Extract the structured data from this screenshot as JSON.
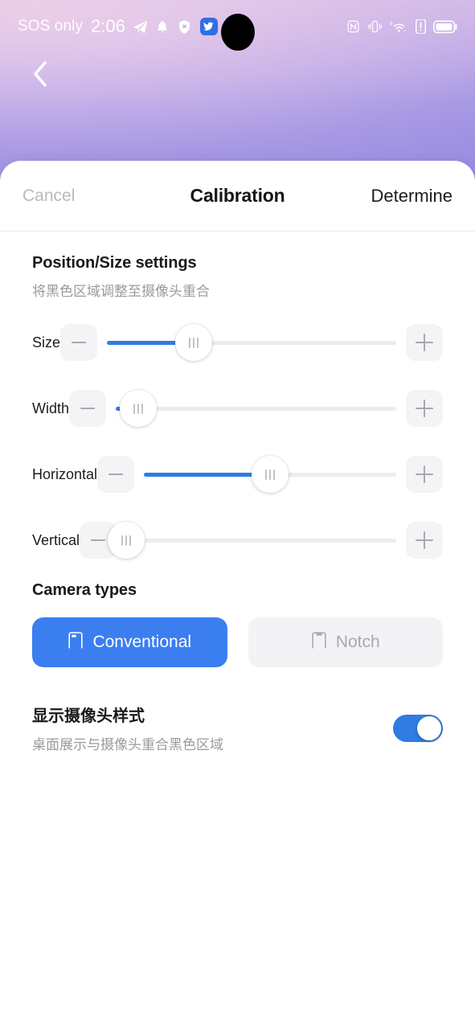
{
  "statusbar": {
    "carrier": "SOS only",
    "time": "2:06",
    "left_icons": [
      "telegram-icon",
      "bell-icon",
      "shield-icon",
      "bird-app-icon",
      "running-app-icon"
    ],
    "right_icons": [
      "nfc-icon",
      "vibrate-icon",
      "wifi6-icon",
      "alert-icon",
      "battery-icon"
    ]
  },
  "nav": {
    "back": "back-chevron"
  },
  "sheet": {
    "cancel_label": "Cancel",
    "title": "Calibration",
    "determine_label": "Determine"
  },
  "position_section": {
    "title": "Position/Size settings",
    "subtitle": "将黑色区域调整至摄像头重合",
    "minus_label": "−",
    "plus_label": "+",
    "sliders": [
      {
        "label": "Size",
        "value": 30
      },
      {
        "label": "Width",
        "value": 8
      },
      {
        "label": "Horizontal",
        "value": 50
      },
      {
        "label": "Vertical",
        "value": 0
      }
    ]
  },
  "camera_section": {
    "title": "Camera types",
    "options": [
      {
        "label": "Conventional",
        "icon": "punch-hole-camera-icon",
        "selected": true
      },
      {
        "label": "Notch",
        "icon": "notch-camera-icon",
        "selected": false
      }
    ]
  },
  "display_style": {
    "title": "显示摄像头样式",
    "subtitle": "桌面展示与摄像头重合黑色区域",
    "enabled": true
  },
  "colors": {
    "accent": "#2f7ce4",
    "selected_button": "#3b7ef0",
    "track": "#ececee",
    "muted_text": "#9a9a9e"
  }
}
